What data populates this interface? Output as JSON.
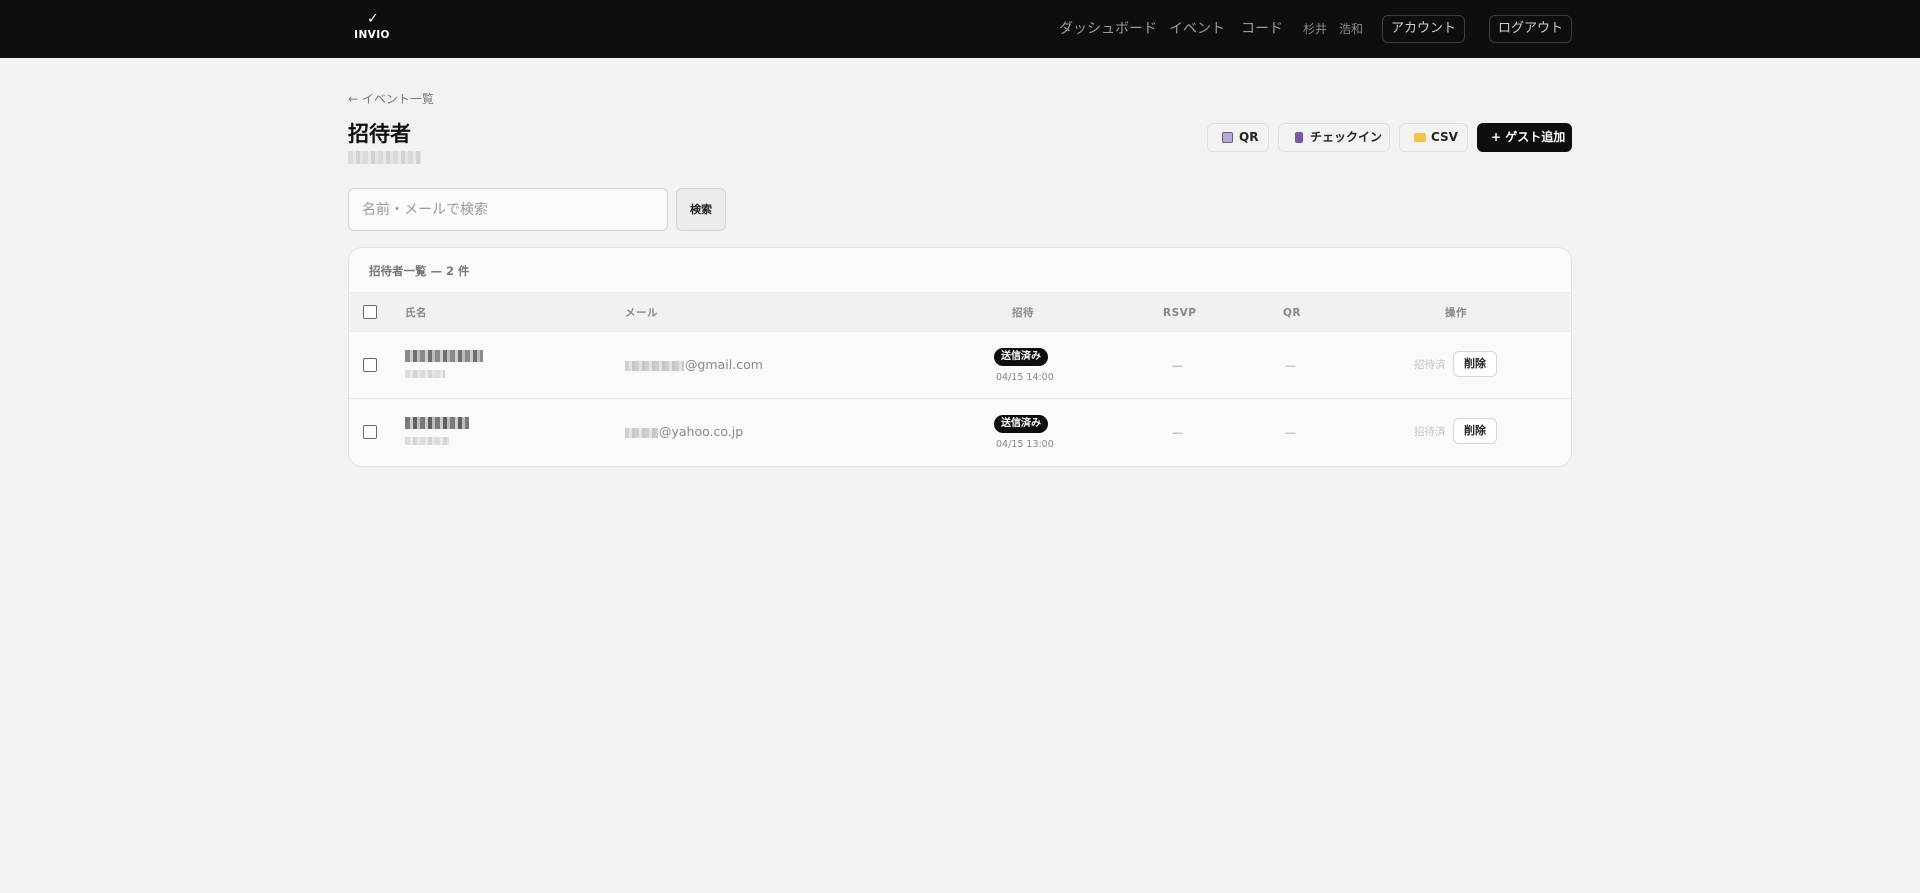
{
  "brand": {
    "logo_check": "✓",
    "logo_text": "INVIO"
  },
  "nav": {
    "links": [
      "ダッシュボード",
      "イベント",
      "コード"
    ],
    "user_name": "杉井　浩和",
    "account_label": "アカウント",
    "logout_label": "ログアウト"
  },
  "page": {
    "back_link": "← イベント一覧",
    "title": "招待者"
  },
  "actions": {
    "qr_label": "QR",
    "checkin_label": "チェックイン",
    "csv_label": "CSV",
    "add_guest_label": "+ ゲスト追加",
    "icon_colors": {
      "qr": "#b9a8d6",
      "checkin": "#7a5c9a",
      "csv": "#f3c24a"
    }
  },
  "search": {
    "placeholder": "名前・メールで検索",
    "value": "",
    "button_label": "検索"
  },
  "table": {
    "title": "招待者一覧 — 2 件",
    "columns": [
      "氏名",
      "メール",
      "招待",
      "RSVP",
      "QR",
      "操作"
    ],
    "rows": [
      {
        "email_domain": "@gmail.com",
        "invite_status": "送信済み",
        "invite_time": "04/15 14:00",
        "rsvp": "—",
        "qr": "—",
        "op_status": "招待済",
        "delete_label": "削除"
      },
      {
        "email_domain": "@yahoo.co.jp",
        "invite_status": "送信済み",
        "invite_time": "04/15 13:00",
        "rsvp": "—",
        "qr": "—",
        "op_status": "招待済",
        "delete_label": "削除"
      }
    ]
  }
}
